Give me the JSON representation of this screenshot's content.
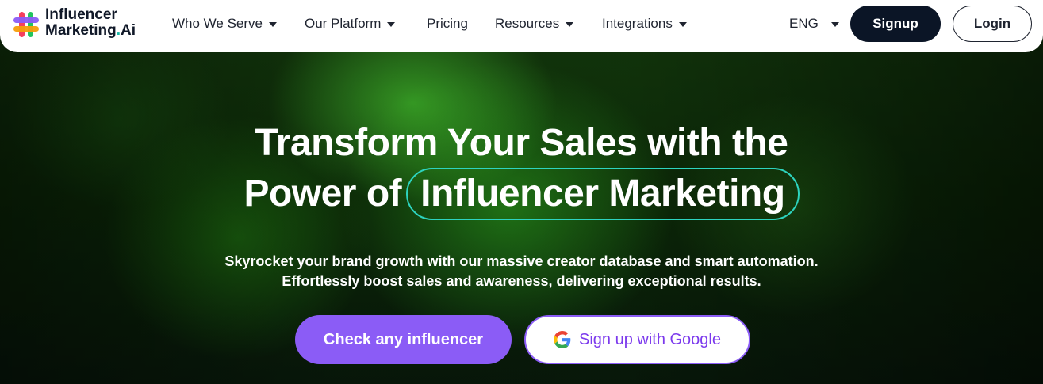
{
  "brand": {
    "line1": "Influencer",
    "line2": "Marketing",
    "dot": ".",
    "suffix": "Ai"
  },
  "nav": {
    "items": [
      {
        "label": "Who We Serve",
        "has_dropdown": true
      },
      {
        "label": "Our Platform",
        "has_dropdown": true
      },
      {
        "label": "Pricing",
        "has_dropdown": false
      },
      {
        "label": "Resources",
        "has_dropdown": true
      },
      {
        "label": "Integrations",
        "has_dropdown": true
      }
    ],
    "language": "ENG",
    "signup_label": "Signup",
    "login_label": "Login"
  },
  "hero": {
    "headline_line1": "Transform Your Sales with the",
    "headline_line2_prefix": "Power of",
    "headline_highlight": "Influencer Marketing",
    "subtitle_line1": "Skyrocket your brand growth with our massive creator database and smart automation.",
    "subtitle_line2": "Effortlessly boost sales and awareness, delivering exceptional results.",
    "cta_primary": "Check any influencer",
    "cta_secondary": "Sign up with Google"
  },
  "colors": {
    "accent_purple": "#8b5cf6",
    "accent_teal": "#2dd4bf",
    "navy": "#0b1526"
  },
  "icons": {
    "logo": "hashtag-logo-icon",
    "google": "google-icon",
    "dropdown": "caret-down-icon"
  }
}
